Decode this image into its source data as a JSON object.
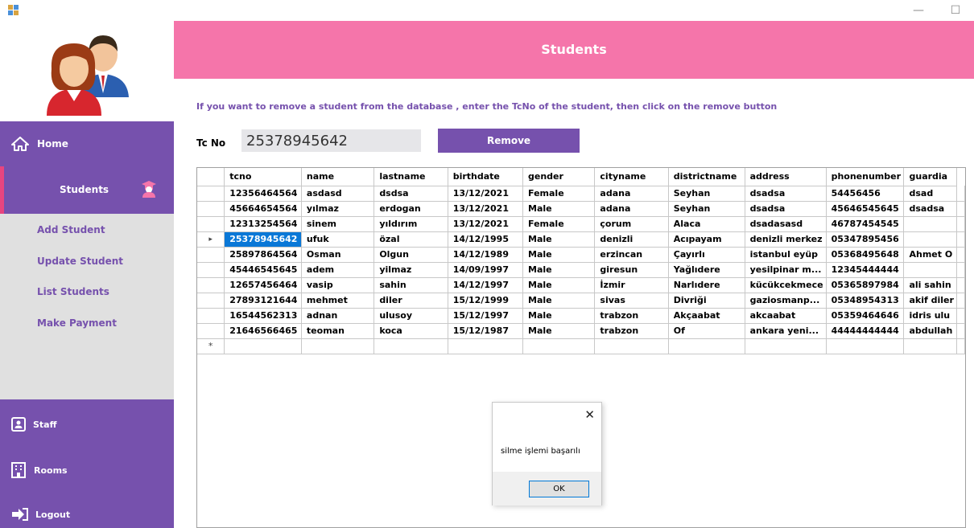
{
  "window": {
    "minimize_glyph": "—",
    "maximize_glyph": "☐"
  },
  "sidebar": {
    "home_label": "Home",
    "students_label": "Students",
    "sub_items": [
      "Add Student",
      "Update Student",
      "List Students",
      "Make Payment"
    ],
    "staff_label": "Staff",
    "rooms_label": "Rooms",
    "logout_label": "Logout"
  },
  "header": {
    "title": "Students"
  },
  "instruction": "If you want to remove a student from the database , enter the TcNo of the student, then click on the remove button",
  "form": {
    "tc_label": "Tc No",
    "tc_value": "25378945642",
    "remove_label": "Remove"
  },
  "grid": {
    "columns": [
      "tcno",
      "name",
      "lastname",
      "birthdate",
      "gender",
      "cityname",
      "districtname",
      "address",
      "phonenumber",
      "guardia"
    ],
    "rows": [
      [
        "12356464564",
        "asdasd",
        "dsdsa",
        "13/12/2021",
        "Female",
        "adana",
        "Seyhan",
        "dsadsa",
        "54456456",
        "dsad"
      ],
      [
        "45664654564",
        "yılmaz",
        "erdogan",
        "13/12/2021",
        "Male",
        "adana",
        "Seyhan",
        "dsadsa",
        "45646545645",
        "dsadsa"
      ],
      [
        "12313254564",
        "sinem",
        "yıldırım",
        "13/12/2021",
        "Female",
        "çorum",
        "Alaca",
        "dsadasasd",
        "46787454545",
        ""
      ],
      [
        "25378945642",
        "ufuk",
        "özal",
        "14/12/1995",
        "Male",
        "denizli",
        "Acıpayam",
        "denizli merkez",
        "05347895456",
        ""
      ],
      [
        "25897864564",
        "Osman",
        "Olgun",
        "14/12/1989",
        "Male",
        "erzincan",
        "Çayırlı",
        "istanbul eyüp",
        "05368495648",
        "Ahmet O"
      ],
      [
        "45446545645",
        "adem",
        "yilmaz",
        "14/09/1997",
        "Male",
        "giresun",
        "Yağlıdere",
        "yesilpinar m...",
        "12345444444",
        ""
      ],
      [
        "12657456464",
        "vasip",
        "sahin",
        "14/12/1997",
        "Male",
        "İzmir",
        "Narlıdere",
        "kücükcekmece",
        "05365897984",
        "ali sahin"
      ],
      [
        "27893121644",
        "mehmet",
        "diler",
        "15/12/1999",
        "Male",
        "sivas",
        "Divriği",
        "gaziosmanp...",
        "05348954313",
        "akif diler"
      ],
      [
        "16544562313",
        "adnan",
        "ulusoy",
        "15/12/1997",
        "Male",
        "trabzon",
        "Akçaabat",
        "akcaabat",
        "05359464646",
        "idris ulu"
      ],
      [
        "21646566465",
        "teoman",
        "koca",
        "15/12/1987",
        "Male",
        "trabzon",
        "Of",
        "ankara yeni...",
        "44444444444",
        "abdullah"
      ]
    ],
    "current_row_marker": "▸",
    "new_row_marker": "*"
  },
  "dialog": {
    "message": "silme işlemi başarılı",
    "ok_label": "OK",
    "close_glyph": "✕"
  }
}
